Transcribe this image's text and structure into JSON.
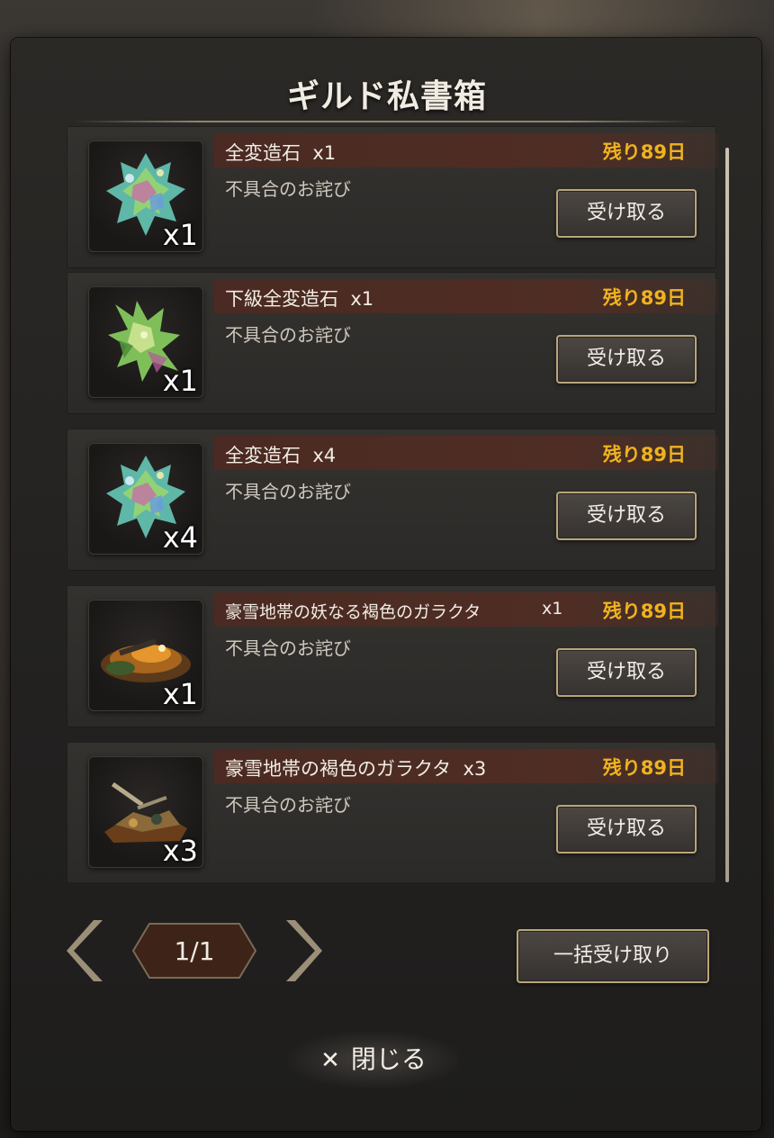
{
  "title": "ギルド私書箱",
  "items": [
    {
      "name": "全変造石  x1",
      "qty_badge": "x1",
      "days": "残り89日",
      "subtitle": "不具合のお詫び",
      "button": "受け取る",
      "icon": "crystal-rainbow-icon"
    },
    {
      "name": "下級全変造石  x1",
      "qty_badge": "x1",
      "days": "残り89日",
      "subtitle": "不具合のお詫び",
      "button": "受け取る",
      "icon": "crystal-green-icon"
    },
    {
      "name": "全変造石  x4",
      "qty_badge": "x4",
      "days": "残り89日",
      "subtitle": "不具合のお詫び",
      "button": "受け取る",
      "icon": "crystal-rainbow-icon"
    },
    {
      "name": "豪雪地帯の妖なる褐色のガラクタ",
      "name_qty": "x1",
      "qty_badge": "x1",
      "days": "残り89日",
      "subtitle": "不具合のお詫び",
      "button": "受け取る",
      "icon": "junk-pile-glowing-icon"
    },
    {
      "name": "豪雪地帯の褐色のガラクタ  x3",
      "qty_badge": "x3",
      "days": "残り89日",
      "subtitle": "不具合のお詫び",
      "button": "受け取る",
      "icon": "junk-pile-icon"
    }
  ],
  "pager": {
    "label": "1/1",
    "prev_icon": "chevron-left-icon",
    "next_icon": "chevron-right-icon"
  },
  "bulk_button": "一括受け取り",
  "close_button": {
    "icon": "✕",
    "label": "閉じる"
  },
  "colors": {
    "days": "#f0b21e",
    "name_bar": "#4f2d24",
    "button_border": "#b8a77a"
  }
}
